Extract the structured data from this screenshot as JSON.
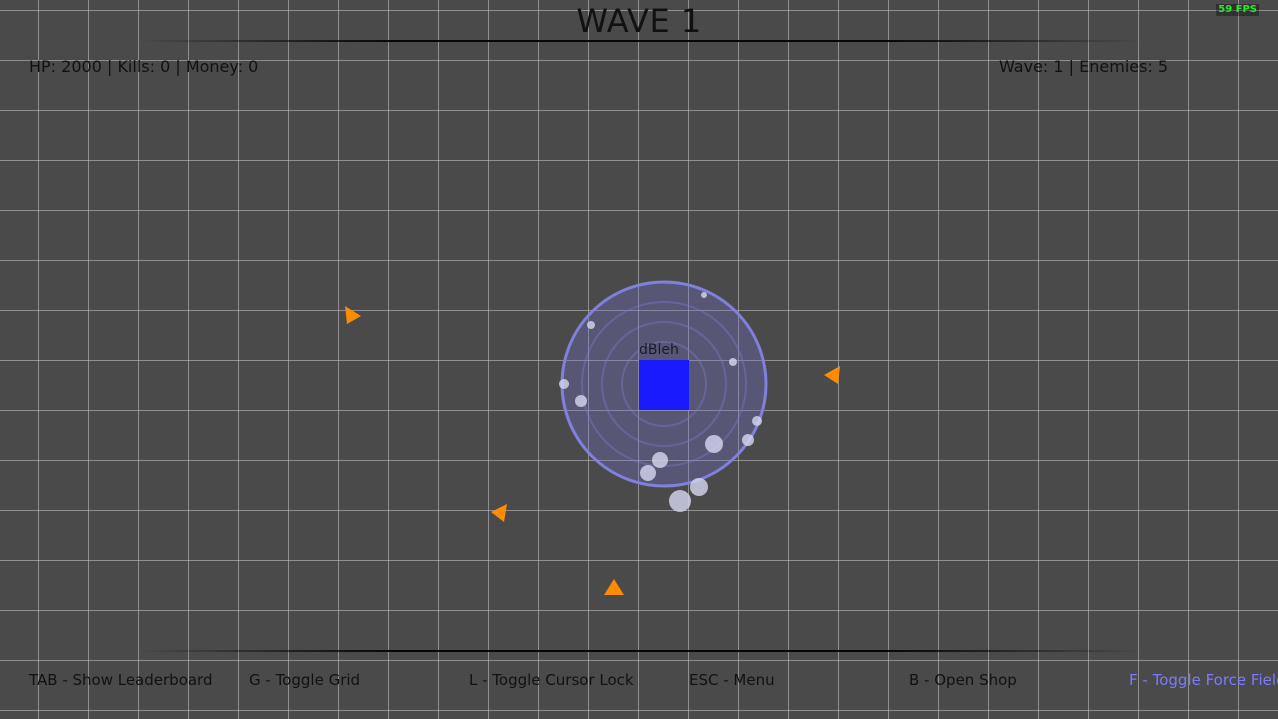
{
  "title": "WAVE 1",
  "fps": "59 FPS",
  "hud": {
    "stats_left": "HP: 2000 | Kills: 0 | Money: 0",
    "stats_right": "Wave: 1 | Enemies: 5"
  },
  "player": {
    "name": "dBleh",
    "color": "#1a1aff",
    "force_field_color": "#8080dd"
  },
  "enemy_color": "#ff8c00",
  "enemies": [
    {
      "id": 1,
      "direction": "right"
    },
    {
      "id": 2,
      "direction": "left"
    },
    {
      "id": 3,
      "direction": "left"
    },
    {
      "id": 4,
      "direction": "up"
    },
    {
      "id": 5,
      "direction": "left"
    }
  ],
  "hints": [
    {
      "label": "TAB - Show Leaderboard",
      "active": false
    },
    {
      "label": "G - Toggle Grid",
      "active": false
    },
    {
      "label": "L - Toggle Cursor Lock",
      "active": false
    },
    {
      "label": "ESC - Menu",
      "active": false
    },
    {
      "label": "B - Open Shop",
      "active": false
    },
    {
      "label": "F - Toggle Force Field",
      "active": true
    }
  ]
}
